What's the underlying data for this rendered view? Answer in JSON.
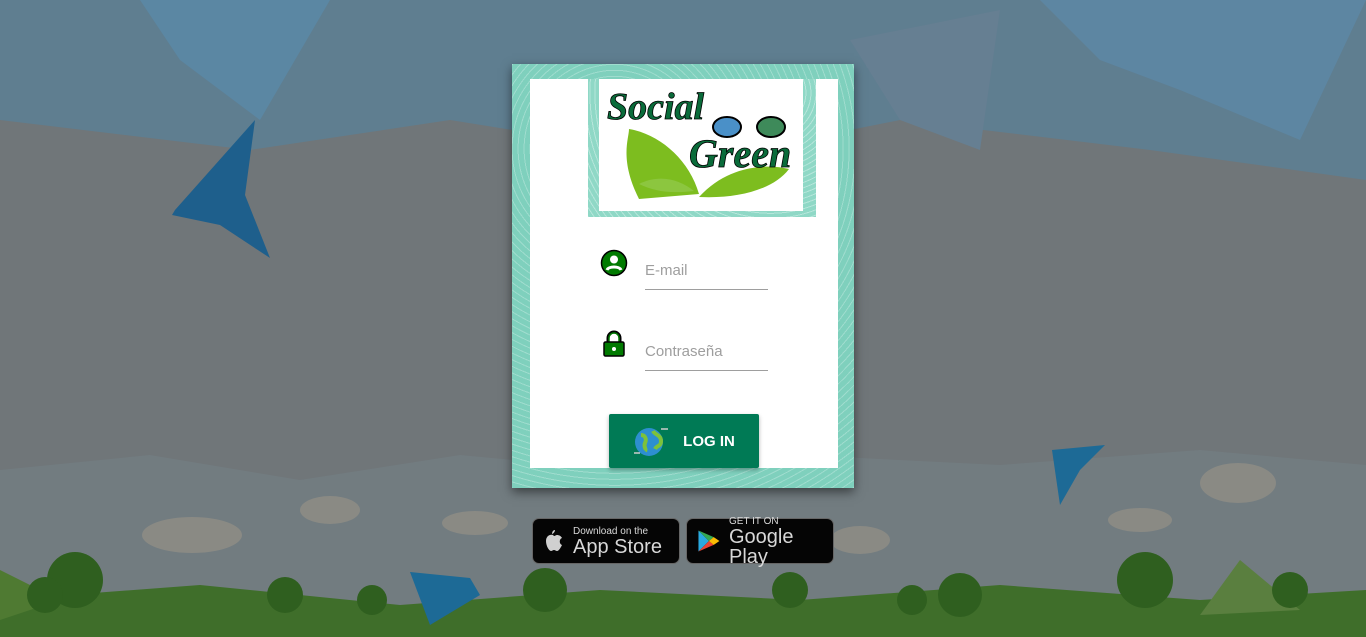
{
  "logo": {
    "line1": "Social",
    "line2": "Green"
  },
  "form": {
    "email_placeholder": "E-mail",
    "email_value": "",
    "password_placeholder": "Contraseña",
    "password_value": "",
    "login_label": "LOG IN"
  },
  "stores": {
    "apple": {
      "small": "Download on the",
      "big": "App Store"
    },
    "google": {
      "small": "GET IT ON",
      "big": "Google Play"
    }
  },
  "colors": {
    "brand_green": "#007a55",
    "icon_green": "#007a00",
    "teal_frame": "#7fd0bd"
  }
}
